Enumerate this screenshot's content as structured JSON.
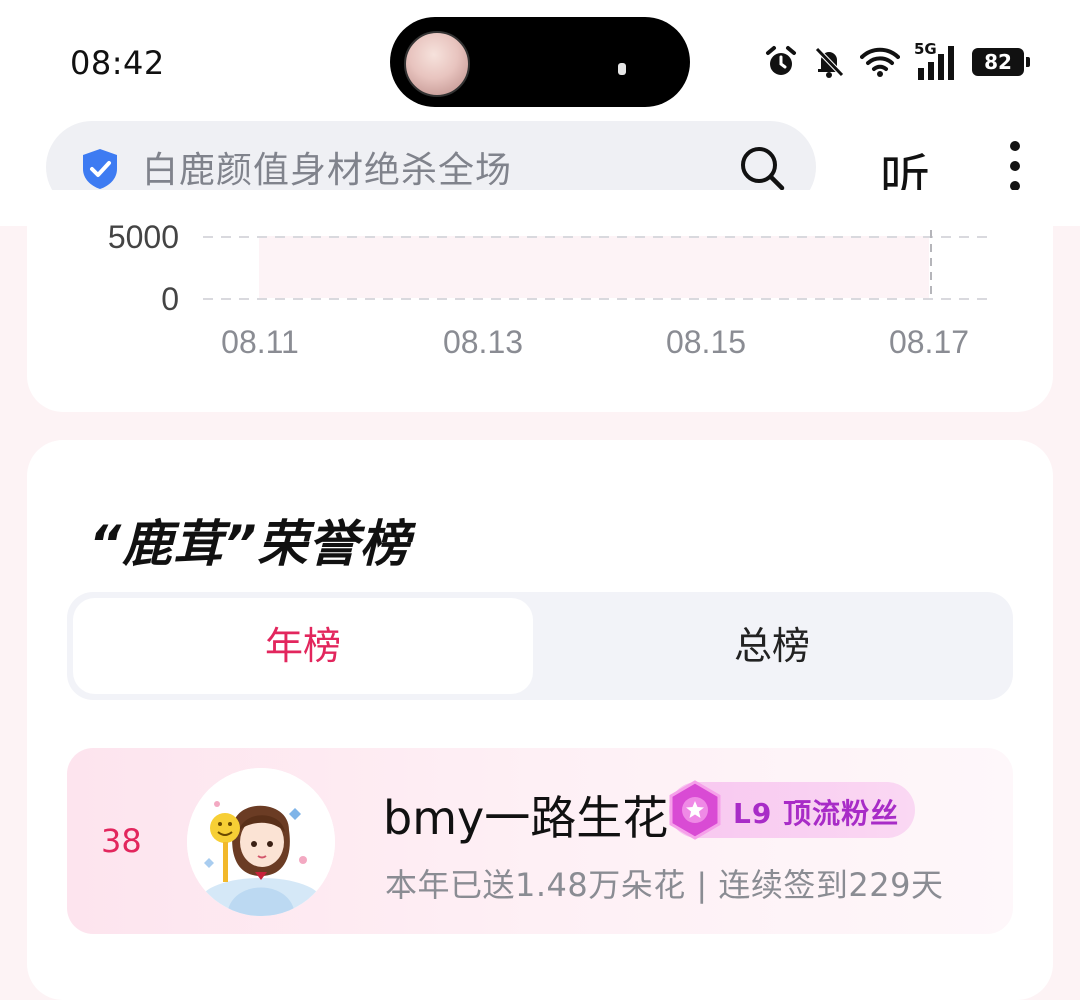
{
  "status_bar": {
    "time": "08:42",
    "signal_label": "5G",
    "battery": "82"
  },
  "search": {
    "placeholder": "白鹿颜值身材绝杀全场",
    "listen_label": "听"
  },
  "chart_data": {
    "type": "line",
    "x_tick_labels": [
      "08.11",
      "08.13",
      "08.15",
      "08.17"
    ],
    "y_tick_labels": [
      "5000",
      "0"
    ],
    "grid": true
  },
  "honor": {
    "title": "“鹿茸”荣誉榜",
    "tabs": [
      {
        "label": "年榜",
        "active": true
      },
      {
        "label": "总榜",
        "active": false
      }
    ],
    "entries": [
      {
        "rank": "38",
        "name": "bmy一路生花",
        "badge": "L9 顶流粉丝",
        "stats": "本年已送1.48万朵花 | 连续签到229天"
      }
    ]
  },
  "colors": {
    "accent": "#e2265d",
    "badge_text": "#a82cc7",
    "shield_blue": "#3d7bf2"
  }
}
